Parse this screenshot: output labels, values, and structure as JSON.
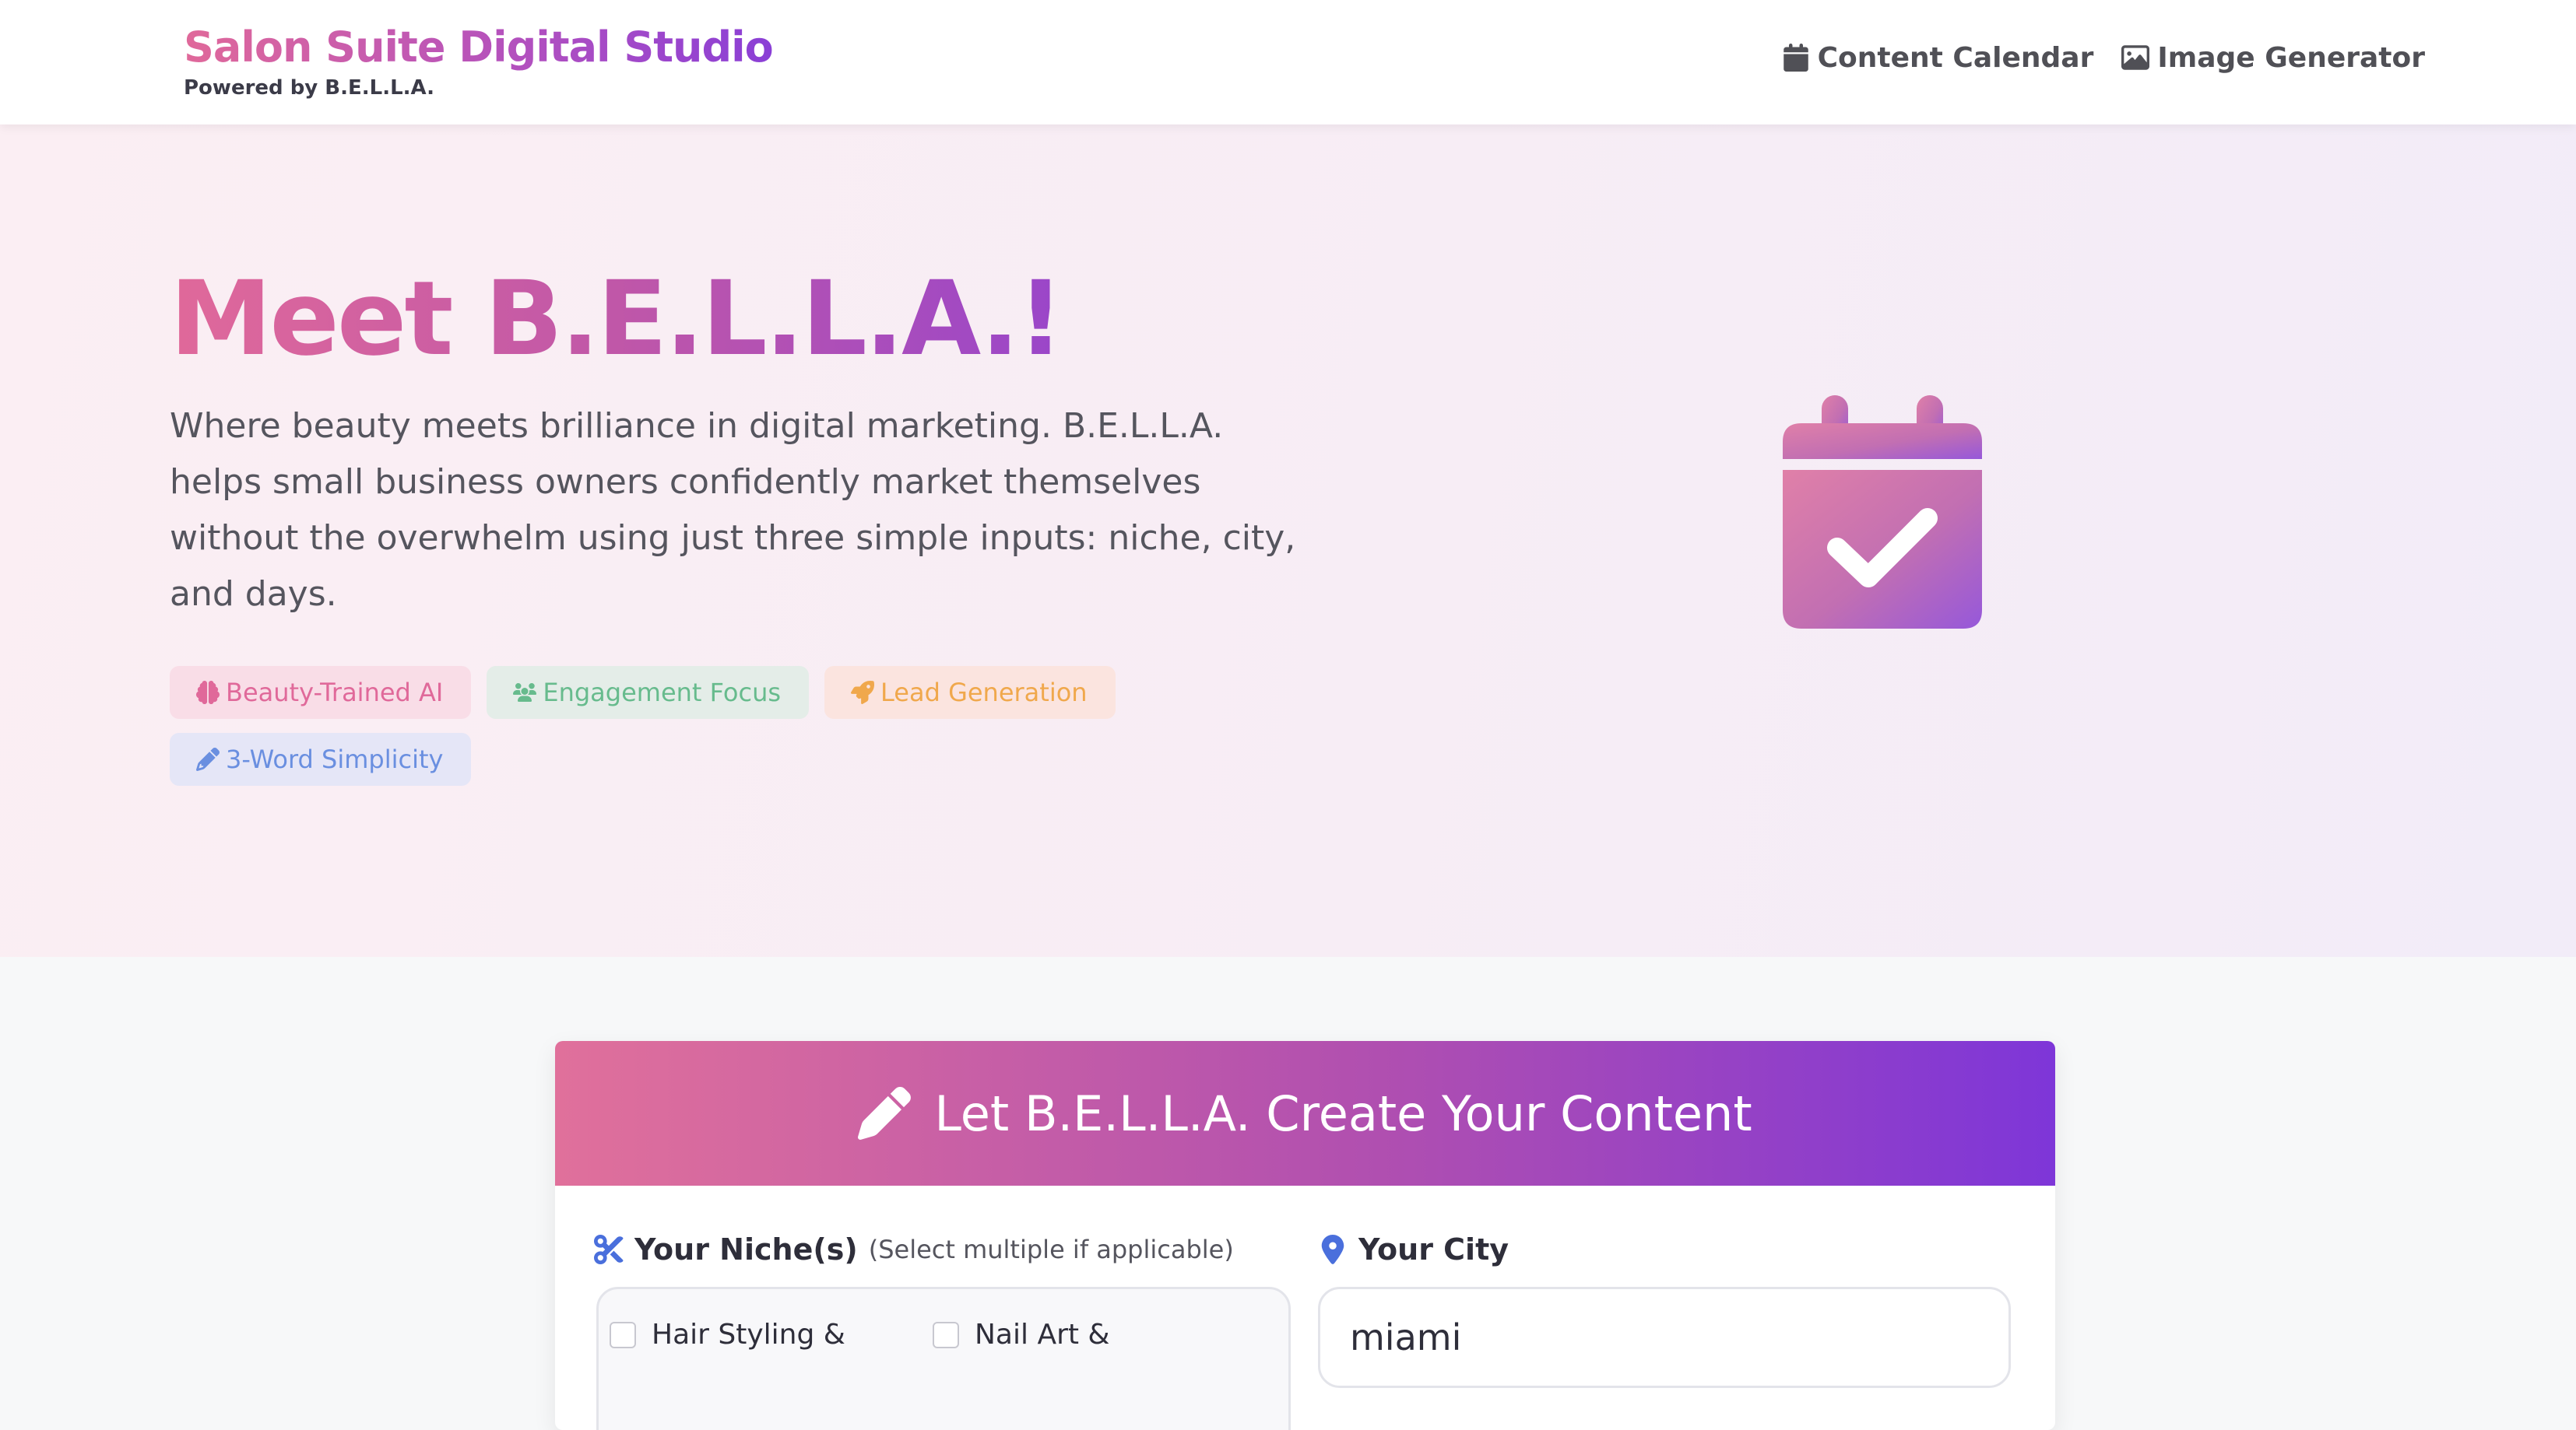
{
  "nav": {
    "brand_title": "Salon Suite Digital Studio",
    "brand_subtitle": "Powered by B.E.L.L.A.",
    "links": [
      {
        "label": "Content Calendar",
        "icon": "calendar-icon"
      },
      {
        "label": "Image Generator",
        "icon": "image-icon"
      }
    ]
  },
  "hero": {
    "title": "Meet B.E.L.L.A.!",
    "description": "Where beauty meets brilliance in digital marketing. B.E.L.L.A. helps small business owners confidently market themselves without the overwhelm using just three simple inputs: niche, city, and days.",
    "tags": [
      {
        "label": "Beauty-Trained AI",
        "icon": "brain-icon",
        "color": "#e0699a"
      },
      {
        "label": "Engagement Focus",
        "icon": "users-icon",
        "color": "#67bb8d"
      },
      {
        "label": "Lead Generation",
        "icon": "rocket-icon",
        "color": "#f0a84c"
      },
      {
        "label": "3-Word Simplicity",
        "icon": "pencil-icon",
        "color": "#6a8fe0"
      }
    ],
    "illustration_icon": "calendar-check-icon"
  },
  "form": {
    "title": "Let B.E.L.L.A. Create Your Content",
    "title_icon": "pencil-icon",
    "niche_label": "Your Niche(s)",
    "niche_hint": "(Select multiple if applicable)",
    "niche_options": [
      "Hair Styling &",
      "Nail Art &"
    ],
    "city_label": "Your City",
    "city_value": "miami"
  },
  "colors": {
    "brand_pink": "#e0699a",
    "brand_purple": "#8a3fd6",
    "label_icon_blue": "#4a6fdc"
  }
}
